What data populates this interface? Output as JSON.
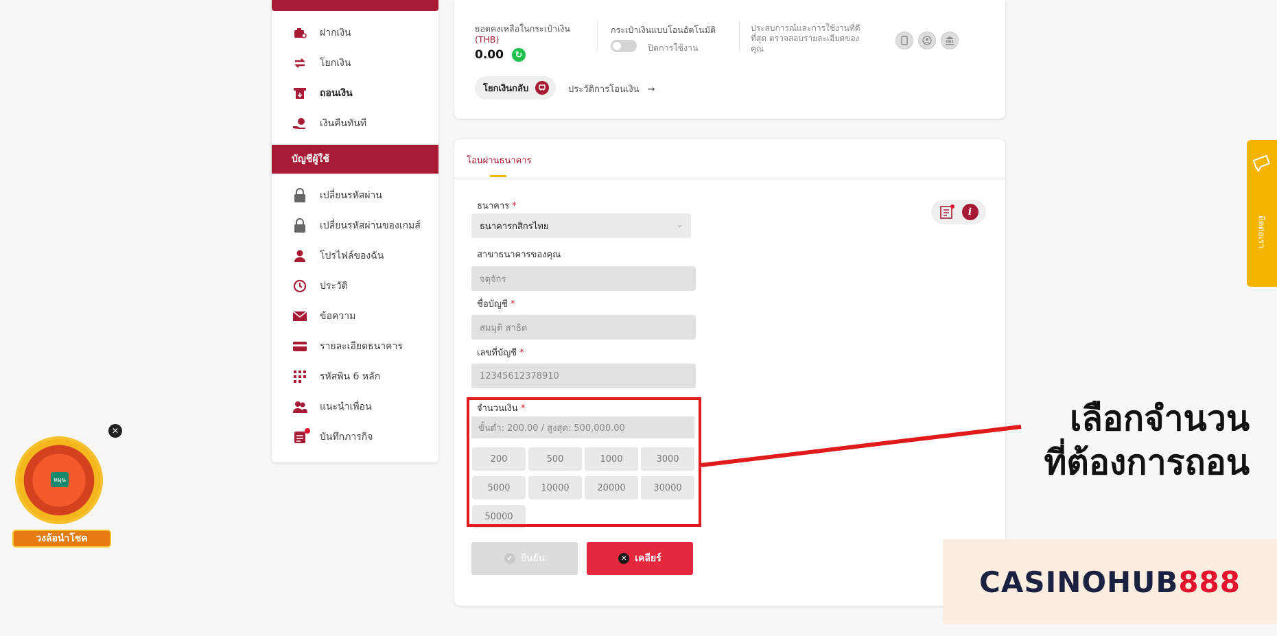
{
  "sidebar": {
    "finance_items": [
      {
        "label": "ฝากเงิน",
        "icon": "deposit-icon"
      },
      {
        "label": "โยกเงิน",
        "icon": "transfer-icon"
      },
      {
        "label": "ถอนเงิน",
        "icon": "withdraw-icon"
      },
      {
        "label": "เงินคืนทันที",
        "icon": "cashback-icon"
      }
    ],
    "account_header": "บัญชีผู้ใช้",
    "account_items": [
      {
        "label": "เปลี่ยนรหัสผ่าน",
        "icon": "lock-icon"
      },
      {
        "label": "เปลี่ยนรหัสผ่านของเกมส์",
        "icon": "lock-icon"
      },
      {
        "label": "โปรไฟล์ของฉัน",
        "icon": "user-icon"
      },
      {
        "label": "ประวัติ",
        "icon": "history-icon"
      },
      {
        "label": "ข้อความ",
        "icon": "mail-icon"
      },
      {
        "label": "รายละเอียดธนาคาร",
        "icon": "card-icon"
      },
      {
        "label": "รหัสพิน 6 หลัก",
        "icon": "pin-icon"
      },
      {
        "label": "แนะนำเพื่อน",
        "icon": "friends-icon"
      },
      {
        "label": "บันทึกภารกิจ",
        "icon": "mission-icon"
      }
    ]
  },
  "wallet": {
    "balance_label": "ยอดคงเหลือในกระเป๋าเงิน",
    "currency": "(THB)",
    "balance": "0.00",
    "auto_transfer_label": "กระเป๋าเงินแบบโอนอัตโนมัติ",
    "auto_transfer_state": "ปิดการใช้งาน",
    "experience_text": "ประสบการณ์และการใช้งานที่ดีที่สุด ตรวจสอบรายละเอียดของคุณ",
    "pull_back_label": "โยกเงินกลับ",
    "transfer_history_label": "ประวัติการโอนเงิน"
  },
  "form": {
    "tab_label": "โอนผ่านธนาคาร",
    "bank_label": "ธนาคาร",
    "bank_value": "ธนาคารกสิกรไทย",
    "branch_label": "สาขาธนาคารของคุณ",
    "branch_value": "จตุจักร",
    "account_name_label": "ชื่อบัญชี",
    "account_name_value": "สมมุติ สาธิต",
    "account_number_label": "เลขที่บัญชี",
    "account_number_value": "12345612378910",
    "amount_label": "จำนวนเงิน",
    "amount_placeholder": "ขั้นต่ำ: 200.00 / สูงสุด: 500,000.00",
    "amount_chips": [
      "200",
      "500",
      "1000",
      "3000",
      "5000",
      "10000",
      "20000",
      "30000",
      "50000"
    ],
    "required_mark": "*",
    "confirm_label": "ยืนยัน",
    "clear_label": "เคลียร์"
  },
  "annotation": {
    "line1": "เลือกจำนวน",
    "line2": "ที่ต้องการถอน",
    "color": "#e11b1b"
  },
  "contact_tab": {
    "label": "ติดต่อเรา"
  },
  "lucky_wheel": {
    "label": "วงล้อนำโชค",
    "center": "หมุน"
  },
  "watermark": {
    "part1": "CASINOHUB",
    "part2": "888"
  },
  "colors": {
    "brand": "#a71a33",
    "accent": "#f5b400",
    "danger": "#e4283d"
  }
}
